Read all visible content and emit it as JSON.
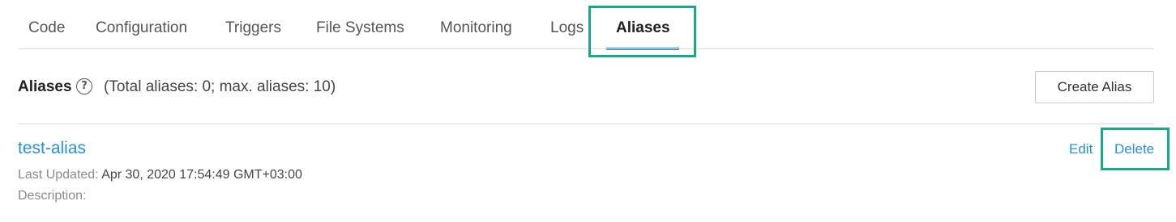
{
  "tabs": [
    {
      "label": "Code"
    },
    {
      "label": "Configuration"
    },
    {
      "label": "Triggers"
    },
    {
      "label": "File Systems"
    },
    {
      "label": "Monitoring"
    },
    {
      "label": "Logs"
    },
    {
      "label": "Aliases",
      "active": true
    }
  ],
  "section": {
    "title": "Aliases",
    "help_icon": "?",
    "count_text": "(Total aliases: 0; max. aliases: 10)",
    "create_button": "Create Alias"
  },
  "alias": {
    "name": "test-alias",
    "last_updated_label": "Last Updated:",
    "last_updated_value": "Apr 30, 2020 17:54:49 GMT+03:00",
    "description_label": "Description:",
    "description_value": "",
    "edit_label": "Edit",
    "delete_label": "Delete"
  },
  "colors": {
    "accent": "#2a8fd8",
    "highlight": "#1aa889"
  }
}
